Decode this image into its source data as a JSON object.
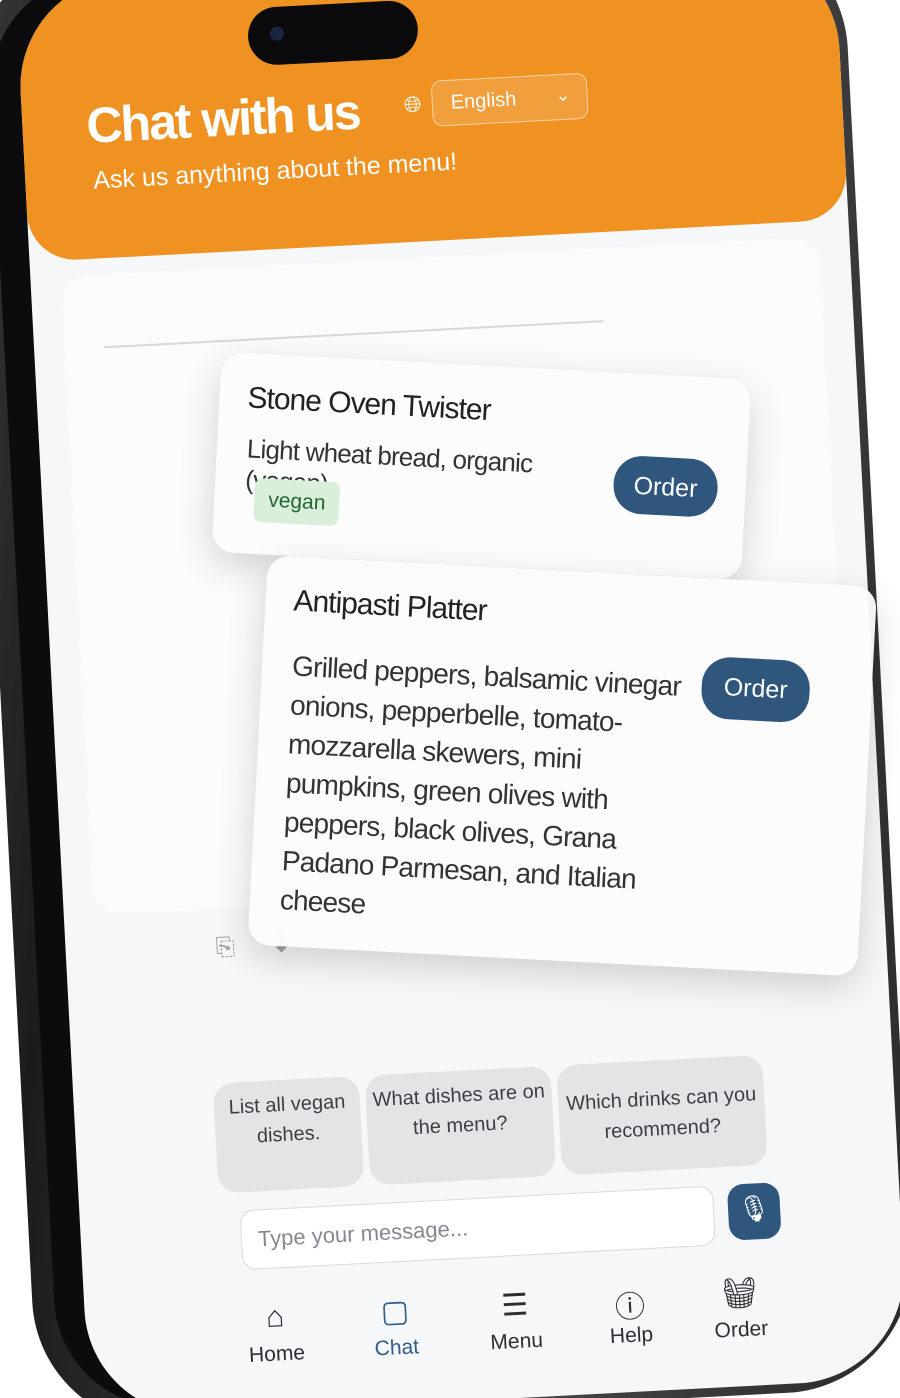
{
  "header": {
    "title": "Chat with us",
    "subtitle": "Ask us anything about the menu!",
    "language": "English"
  },
  "menu_cards": [
    {
      "name": "Stone Oven Twister",
      "description": "Light wheat bread, organic (vegan)",
      "tag": "vegan",
      "button": "Order"
    },
    {
      "name": "Antipasti Platter",
      "description": "Grilled peppers, balsamic vinegar onions, pepperbelle, tomato-mozzarella skewers, mini pumpkins, green olives with peppers, black olives, Grana Padano Parmesan, and Italian cheese",
      "button": "Order"
    }
  ],
  "suggestions": [
    "List all vegan dishes.",
    "What dishes are on the menu?",
    "Which drinks can you recommend?"
  ],
  "composer": {
    "placeholder": "Type your message..."
  },
  "nav": {
    "items": [
      {
        "label": "Home",
        "icon": "home-icon"
      },
      {
        "label": "Chat",
        "icon": "chat-icon"
      },
      {
        "label": "Menu",
        "icon": "menu-book-icon"
      },
      {
        "label": "Help",
        "icon": "help-circle-icon"
      },
      {
        "label": "Order",
        "icon": "basket-icon"
      }
    ],
    "active": "Chat"
  },
  "colors": {
    "header": "#ef9222",
    "primary_button": "#2f567c",
    "vegan_tag_bg": "#d9efd9",
    "vegan_tag_text": "#226633"
  }
}
